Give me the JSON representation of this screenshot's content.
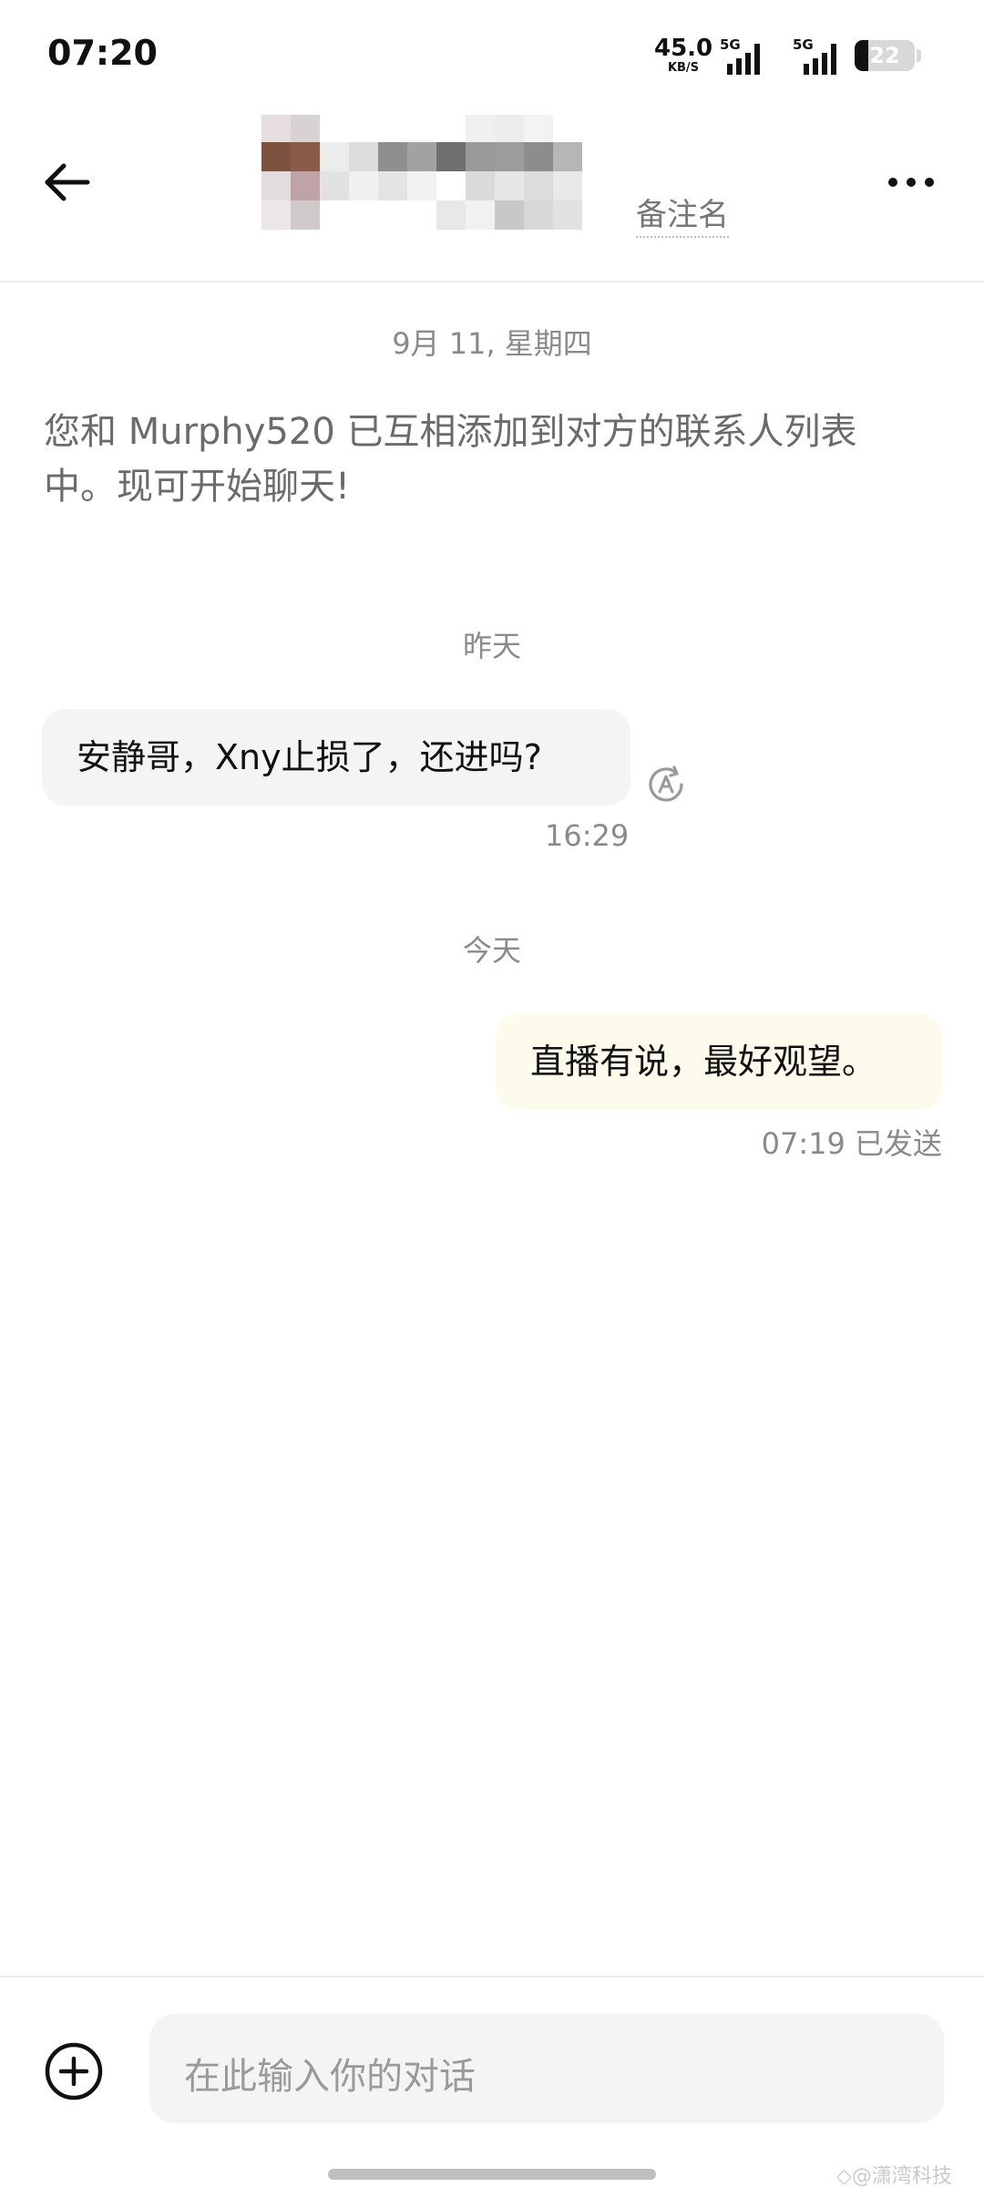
{
  "status_bar": {
    "time": "07:20",
    "net_speed_value": "45.0",
    "net_speed_unit": "KB/S",
    "sim1_label": "5G",
    "sim2_label": "5G",
    "battery_level": "22"
  },
  "header": {
    "contact_name_hidden": true,
    "remark_label": "备注名"
  },
  "chat": {
    "date_first": "9月 11, 星期四",
    "system_notice": "您和 Murphy520 已互相添加到对方的联系人列表中。现可开始聊天!",
    "date_yesterday": "昨天",
    "incoming_message": {
      "text": "安静哥，Xny止损了，还进吗?",
      "time": "16:29"
    },
    "date_today": "今天",
    "outgoing_message": {
      "text": "直播有说，最好观望。",
      "time_status": "07:19 已发送"
    }
  },
  "input": {
    "placeholder": "在此输入你的对话"
  },
  "watermark": "◇@潇湾科技",
  "colors": {
    "incoming_bubble": "#f4f4f4",
    "outgoing_bubble": "#fdfbec",
    "muted_text": "#8a8a8a"
  },
  "icons": {
    "back": "back-arrow-icon",
    "more": "more-dots-icon",
    "translate": "translate-icon",
    "add": "plus-circle-icon"
  }
}
